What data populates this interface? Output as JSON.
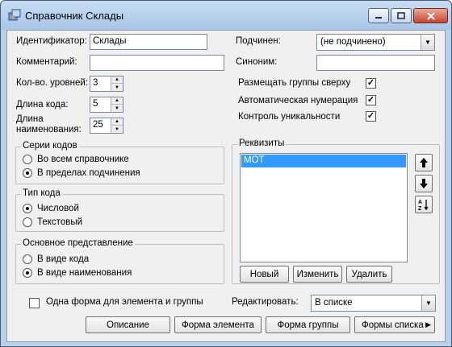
{
  "window": {
    "title": "Справочник Склады"
  },
  "left": {
    "identifier_label": "Идентификатор:",
    "identifier_value": "Склады",
    "comment_label": "Комментарий:",
    "comment_value": "",
    "levels_label": "Кол-во. уровней:",
    "levels_value": "3",
    "code_length_label": "Длина кода:",
    "code_length_value": "5",
    "name_length_label_1": "Длина",
    "name_length_label_2": "наименования:",
    "name_length_value": "25"
  },
  "right": {
    "subordinate_label": "Подчинен:",
    "subordinate_value": "(не подчинено)",
    "synonym_label": "Синоним:",
    "synonym_value": "",
    "groups_on_top_label": "Размещать группы сверху",
    "groups_on_top_checked": true,
    "auto_numbering_label": "Автоматическая нумерация",
    "auto_numbering_checked": true,
    "uniqueness_label": "Контроль уникальности",
    "uniqueness_checked": true
  },
  "code_series": {
    "title": "Серии кодов",
    "options": [
      "Во всем справочнике",
      "В пределах подчинения"
    ],
    "selected_index": 1
  },
  "code_type": {
    "title": "Тип кода",
    "options": [
      "Числовой",
      "Текстовый"
    ],
    "selected_index": 0
  },
  "main_view": {
    "title": "Основное представление",
    "options": [
      "В виде кода",
      "В виде наименования"
    ],
    "selected_index": 1
  },
  "requisites": {
    "title": "Реквизиты",
    "items": [
      "МОТ"
    ],
    "new_label": "Новый",
    "edit_label": "Изменить",
    "delete_label": "Удалить"
  },
  "bottom": {
    "one_form_label": "Одна форма для элемента и группы",
    "one_form_checked": false,
    "edit_label": "Редактировать:",
    "edit_value": "В списке",
    "buttons": {
      "description": "Описание",
      "element_form": "Форма элемента",
      "group_form": "Форма группы",
      "list_forms": "Формы списка"
    }
  }
}
